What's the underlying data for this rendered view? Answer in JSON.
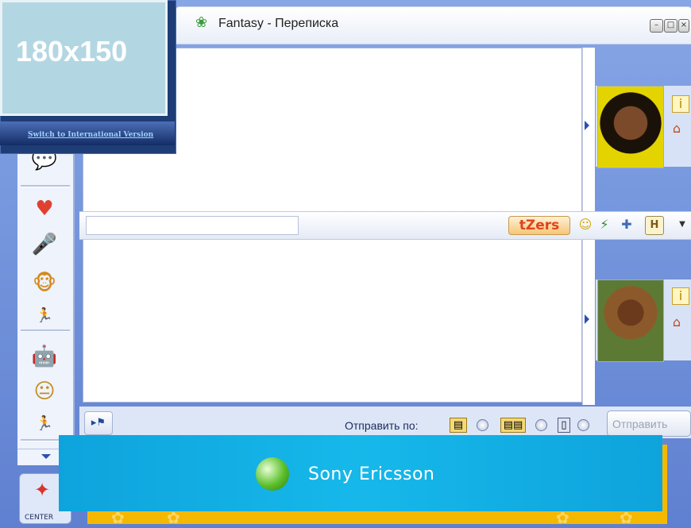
{
  "window": {
    "title": "Fantasy - Переписка",
    "controls": [
      "minimize",
      "maximize",
      "close"
    ]
  },
  "ad": {
    "placeholder_text": "180x150",
    "link_text": "Switch to International Version"
  },
  "left_toolbar": {
    "icons": [
      "chat-bubble-icon",
      "greeting-card-icon",
      "microphone-icon",
      "monkey-mascot-icon",
      "running-man-icon",
      "robot-icon",
      "sumo-icon",
      "running-man-icon"
    ],
    "center_label": "CENTER"
  },
  "contacts": [
    {
      "name_icon": "afro-avatar-icon"
    },
    {
      "name_icon": "monkey-avatar-icon"
    }
  ],
  "format_toolbar": {
    "tzers_label": "tZers",
    "letter_button": "H"
  },
  "send_bar": {
    "send_by_label": "Отправить по:",
    "send_button": "Отправить"
  },
  "banner": {
    "brand": "Sony Ericsson"
  },
  "colors": {
    "frame_blue": "#6f8fd6",
    "banner_blue": "#16b8ea",
    "tzers_red": "#e0431c"
  }
}
